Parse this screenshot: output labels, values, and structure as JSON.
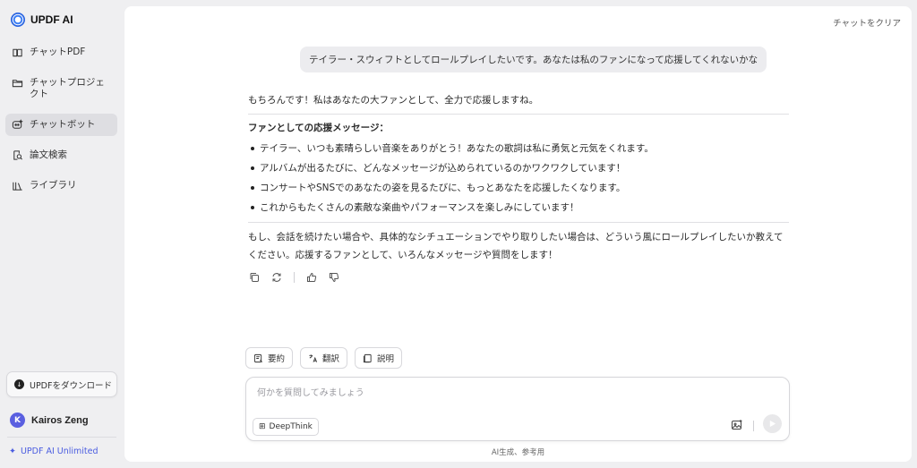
{
  "sidebar": {
    "brand": "UPDF AI",
    "items": [
      {
        "label": "チャットPDF",
        "icon": "book-icon"
      },
      {
        "label": "チャットプロジェクト",
        "icon": "folder-icon"
      },
      {
        "label": "チャットボット",
        "icon": "chatbot-icon",
        "active": true
      },
      {
        "label": "論文検索",
        "icon": "paper-search-icon"
      },
      {
        "label": "ライブラリ",
        "icon": "library-icon"
      }
    ],
    "download_label": "UPDFをダウンロード",
    "user_initial": "K",
    "user_name": "Kairos Zeng",
    "unlimited_label": "UPDF AI Unlimited"
  },
  "main": {
    "clear_label": "チャットをクリア",
    "user_message": "テイラー・スウィフトとしてロールプレイしたいです。あなたは私のファンになって応援してくれないかな",
    "ai_message": {
      "intro": "もちろんです！私はあなたの大ファンとして、全力で応援しますね。",
      "heading": "ファンとしての応援メッセージ：",
      "bullets": [
        "テイラー、いつも素晴らしい音楽をありがとう！あなたの歌詞は私に勇気と元気をくれます。",
        "アルバムが出るたびに、どんなメッセージが込められているのかワクワクしています！",
        "コンサートやSNSでのあなたの姿を見るたびに、もっとあなたを応援したくなります。",
        "これからもたくさんの素敵な楽曲やパフォーマンスを楽しみにしています！"
      ],
      "closing": "もし、会話を続けたい場合や、具体的なシチュエーションでやり取りしたい場合は、どういう風にロールプレイしたいか教えてください。応援するファンとして、いろんなメッセージや質問をします！"
    },
    "chips": {
      "summarize": "要約",
      "translate": "翻訳",
      "explain": "説明"
    },
    "input": {
      "placeholder": "何かを質問してみましょう",
      "value": ""
    },
    "deepthink_label": "DeepThink",
    "footer_note": "AI生成、参考用"
  },
  "colors": {
    "accent": "#4a5ce0",
    "sidebar_bg": "#efeff1",
    "panel_bg": "#ffffff",
    "user_bubble": "#ececef"
  }
}
